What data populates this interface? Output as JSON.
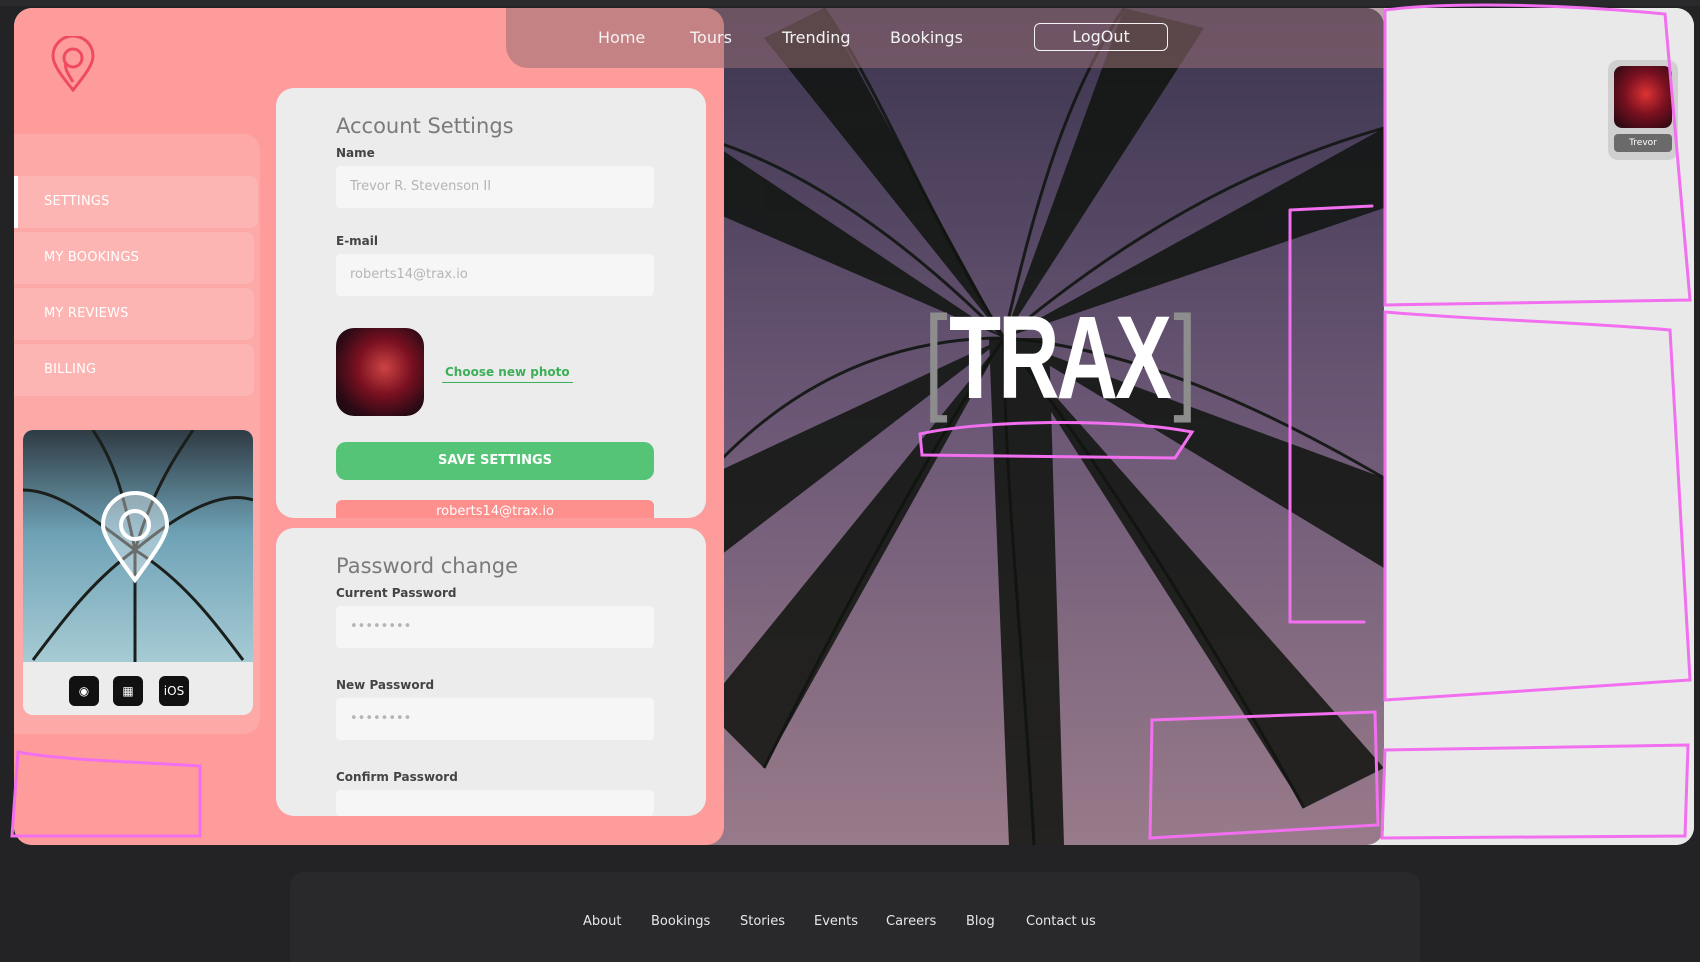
{
  "nav": {
    "items": [
      "Home",
      "Tours",
      "Trending",
      "Bookings"
    ],
    "logout": "LogOut"
  },
  "sidebar": {
    "items": [
      {
        "label": "SETTINGS",
        "active": true
      },
      {
        "label": "MY BOOKINGS",
        "active": false
      },
      {
        "label": "MY REVIEWS",
        "active": false
      },
      {
        "label": "BILLING",
        "active": false
      }
    ],
    "stores": [
      "android",
      "windows",
      "iOS"
    ]
  },
  "account": {
    "title": "Account Settings",
    "name_label": "Name",
    "name_value": "Trevor R. Stevenson II",
    "email_label": "E-mail",
    "email_value": "roberts14@trax.io",
    "choose_photo": "Choose new photo",
    "save": "SAVE SETTINGS",
    "email_bar": "roberts14@trax.io"
  },
  "password": {
    "title": "Password change",
    "current_label": "Current Password",
    "current_value": "••••••••",
    "new_label": "New Password",
    "new_value": "••••••••",
    "confirm_label": "Confirm Password"
  },
  "hero": {
    "logo_text": "TRAX",
    "bracket_open": "[",
    "bracket_close": "]"
  },
  "user": {
    "name": "Trevor"
  },
  "footer": {
    "links": [
      "About",
      "Bookings",
      "Stories",
      "Events",
      "Careers",
      "Blog",
      "Contact us"
    ]
  },
  "colors": {
    "panel": "#fd9c9a",
    "accent_green": "#55c476",
    "annotation": "#f26ff0"
  }
}
